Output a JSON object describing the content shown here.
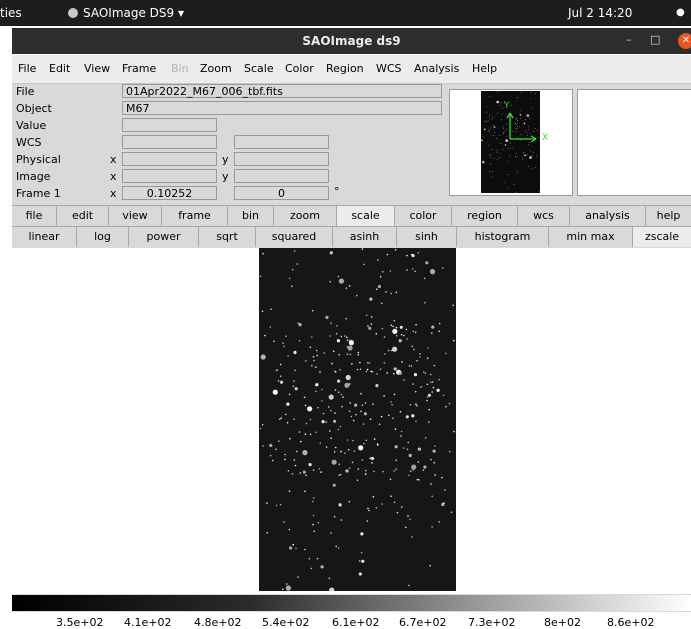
{
  "topbar": {
    "activities": "ties",
    "app": "SAOImage DS9 ▾",
    "clock": "Jul 2  14:20",
    "dot": "●"
  },
  "window": {
    "title": "SAOImage ds9",
    "minimize": "–",
    "maximize": "□",
    "close": "✕"
  },
  "menubar": [
    "File",
    "Edit",
    "View",
    "Frame",
    "Bin",
    "Zoom",
    "Scale",
    "Color",
    "Region",
    "WCS",
    "Analysis",
    "Help"
  ],
  "info": {
    "labels": {
      "file": "File",
      "object": "Object",
      "value": "Value",
      "wcs": "WCS",
      "physical": "Physical",
      "image": "Image",
      "frame": "Frame 1"
    },
    "file": "01Apr2022_M67_006_tbf.fits",
    "object": "M67",
    "x": "x",
    "y": "y",
    "frame_zoom": "0.10252",
    "frame_angle": "0",
    "degree": "°"
  },
  "compass": {
    "y": "Y",
    "x": "X"
  },
  "buttonbar": [
    "file",
    "edit",
    "view",
    "frame",
    "bin",
    "zoom",
    "scale",
    "color",
    "region",
    "wcs",
    "analysis",
    "help"
  ],
  "scalebar": [
    "linear",
    "log",
    "power",
    "sqrt",
    "squared",
    "asinh",
    "sinh",
    "histogram",
    "min max",
    "zscale"
  ],
  "colorbar_ticks": [
    "3.5e+02",
    "4.1e+02",
    "4.8e+02",
    "5.4e+02",
    "6.1e+02",
    "6.7e+02",
    "7.3e+02",
    "8e+02",
    "8.6e+02"
  ]
}
